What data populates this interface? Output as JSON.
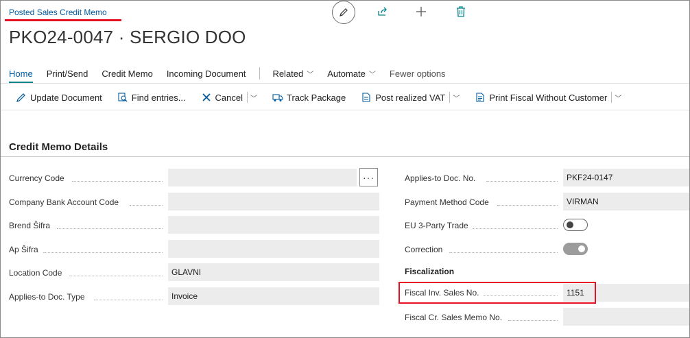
{
  "page_type": "Posted Sales Credit Memo",
  "title": "PKO24-0047 · SERGIO DOO",
  "top_icons": [
    "edit-icon",
    "share-icon",
    "add-icon",
    "delete-icon"
  ],
  "nav": {
    "home": "Home",
    "print_send": "Print/Send",
    "credit_memo": "Credit Memo",
    "incoming_document": "Incoming Document",
    "related": "Related",
    "automate": "Automate",
    "fewer_options": "Fewer options"
  },
  "actions": {
    "update_document": "Update Document",
    "find_entries": "Find entries...",
    "cancel": "Cancel",
    "track_package": "Track Package",
    "post_realized_vat": "Post realized VAT",
    "print_fiscal": "Print Fiscal Without Customer"
  },
  "section": {
    "title": "Credit Memo Details"
  },
  "left_fields": [
    {
      "label": "Currency Code",
      "value": ""
    },
    {
      "label": "Company Bank Account Code",
      "value": ""
    },
    {
      "label": "Brend Šifra",
      "value": ""
    },
    {
      "label": "Ap Šifra",
      "value": ""
    },
    {
      "label": "Location Code",
      "value": "GLAVNI"
    },
    {
      "label": "Applies-to Doc. Type",
      "value": "Invoice"
    }
  ],
  "right_fields": {
    "applies_to_doc_no": {
      "label": "Applies-to Doc. No.",
      "value": "PKF24-0147"
    },
    "payment_method_code": {
      "label": "Payment Method Code",
      "value": "VIRMAN"
    },
    "eu_3_party_trade": {
      "label": "EU 3-Party Trade",
      "checked": false
    },
    "correction": {
      "label": "Correction",
      "checked": true
    },
    "fiscalization_title": "Fiscalization",
    "fiscal_inv_sales_no": {
      "label": "Fiscal Inv. Sales No.",
      "value": "1151"
    },
    "fiscal_cr_sales_memo_no": {
      "label": "Fiscal Cr. Sales Memo No.",
      "value": ""
    }
  },
  "lookup_label": "···",
  "colors": {
    "accent": "#008489",
    "link": "#005a9e",
    "highlight": "#e81123"
  }
}
